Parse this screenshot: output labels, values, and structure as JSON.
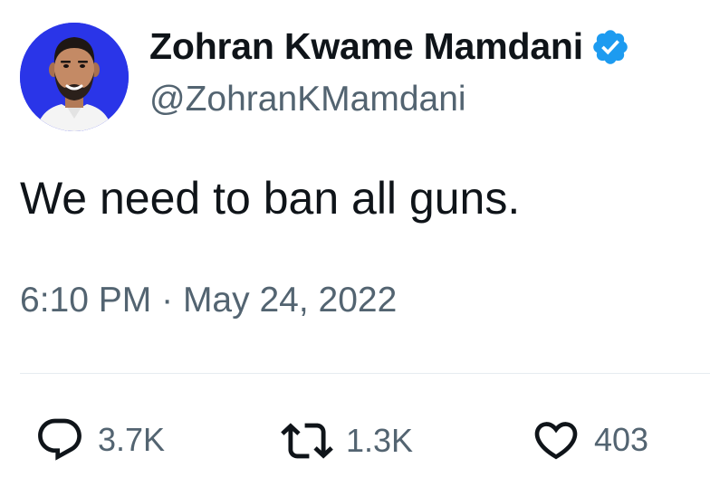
{
  "author": {
    "display_name": "Zohran Kwame Mamdani",
    "handle": "@ZohranKMamdani",
    "verified": true,
    "verified_icon": "verified-badge-icon",
    "verified_color": "#1d9bf0",
    "avatar_background": "#2a35e8"
  },
  "tweet": {
    "text": "We need to ban all guns.",
    "time": "6:10 PM",
    "separator": "·",
    "date": "May 24, 2022"
  },
  "actions": {
    "reply": {
      "icon": "reply-icon",
      "count": "3.7K"
    },
    "retweet": {
      "icon": "retweet-icon",
      "count": "1.3K"
    },
    "like": {
      "icon": "heart-icon",
      "count": "403"
    }
  },
  "colors": {
    "text": "#0f1419",
    "secondary": "#536471",
    "divider": "#e6ecf0"
  }
}
